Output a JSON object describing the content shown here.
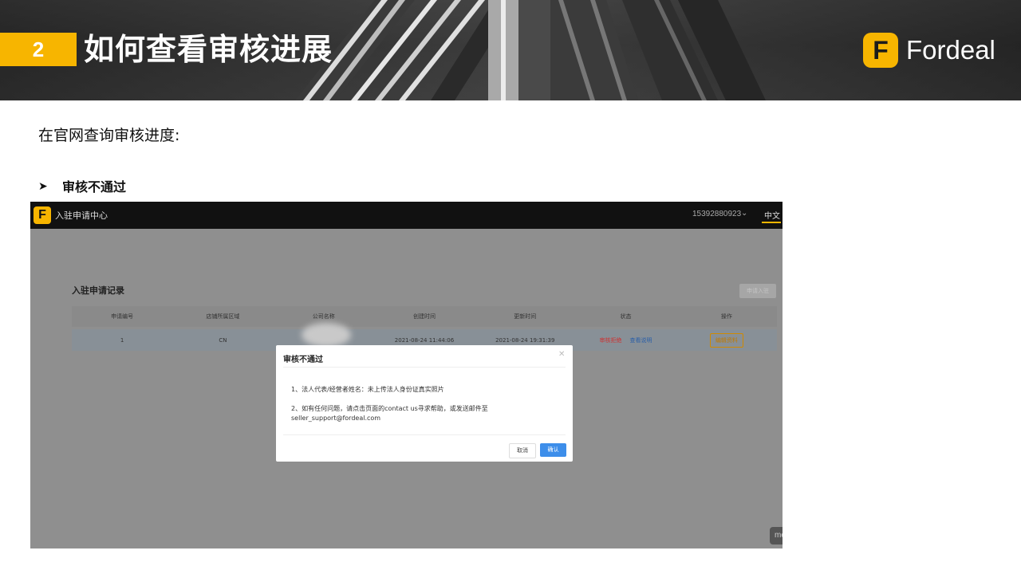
{
  "slide": {
    "section_number": "2",
    "title": "如何查看审核进展",
    "brand_logo_letter": "F",
    "brand_name": "Fordeal",
    "intro": "在官网查询审核进度:",
    "bullet_icon": "arrow-bullet-icon",
    "bullet": "审核不通过"
  },
  "screenshot": {
    "app_logo_letter": "F",
    "app_title": "入驻申请中心",
    "account_phone": "15392880923",
    "language": "中文",
    "page_heading": "入驻申请记录",
    "new_button": "申请入驻",
    "table": {
      "headers": [
        "申请编号",
        "店铺所属区域",
        "公司名称",
        "创建时间",
        "更新时间",
        "状态",
        "操作"
      ],
      "row": {
        "id": "1",
        "region": "CN",
        "company": "",
        "created": "2021-08-24 11:44:06",
        "updated": "2021-08-24 19:31:39",
        "status": "审核拒绝",
        "status_link": "查看说明",
        "action": "编辑资料"
      }
    },
    "dialog": {
      "title": "审核不通过",
      "line1": "1、法人代表/经营者姓名：未上传法人身份证真实照片",
      "line2a": "2、如有任何问题，请点击页面的contact us寻求帮助，或发送邮件至",
      "line2b": "seller_support@fordeal.com",
      "cancel": "取消",
      "confirm": "确认"
    },
    "corner_widget": "me"
  },
  "colors": {
    "brand_yellow": "#f7b500",
    "confirm_blue": "#3d8eea",
    "reject_red": "#cc3333"
  }
}
